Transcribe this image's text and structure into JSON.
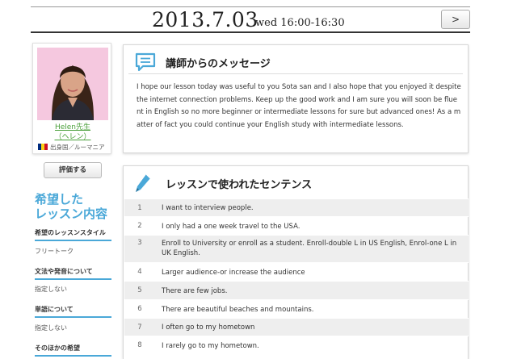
{
  "header": {
    "date": "2013.7.03",
    "day_time": "wed 16:00-16:30",
    "next_label": ">"
  },
  "teacher": {
    "name": "Helen先生",
    "name_kana": "（ヘレン）",
    "country": "出身国／ルーマニア",
    "evaluate_label": "評価する"
  },
  "preferences": {
    "title_line1": "希望した",
    "title_line2": "レッスン内容",
    "items": [
      {
        "heading": "希望のレッスンスタイル",
        "value": "フリートーク"
      },
      {
        "heading": "文法や発音について",
        "value": "指定しない"
      },
      {
        "heading": "単語について",
        "value": "指定しない"
      },
      {
        "heading": "そのほかの希望",
        "value": ""
      }
    ]
  },
  "message": {
    "title": "講師からのメッセージ",
    "body": "I hope our lesson today was useful to you Sota san and I also hope that you enjoyed it despite the internet connection problems. Keep up the good work and I am sure you will soon be fluent in English so no more beginner or intermediate lessons for sure but advanced ones! As a matter of fact you could continue your English study with intermediate lessons."
  },
  "sentences": {
    "title": "レッスンで使われたセンテンス",
    "rows": [
      {
        "num": "1",
        "text": "I want to interview people."
      },
      {
        "num": "2",
        "text": "I only had a one week travel to the USA."
      },
      {
        "num": "3",
        "text": "Enroll to University or enroll as a student. Enroll-double L in US English, Enrol-one L in UK English."
      },
      {
        "num": "4",
        "text": "Larger audience-or increase the audience"
      },
      {
        "num": "5",
        "text": "There are few jobs."
      },
      {
        "num": "6",
        "text": "There are beautiful beaches and mountains."
      },
      {
        "num": "7",
        "text": "I often go to my hometown"
      },
      {
        "num": "8",
        "text": "I rarely go to my hometown."
      }
    ]
  },
  "colors": {
    "accent_blue": "#4aa8d8",
    "link_green": "#4a9f3a",
    "photo_bg": "#f5c8df"
  }
}
